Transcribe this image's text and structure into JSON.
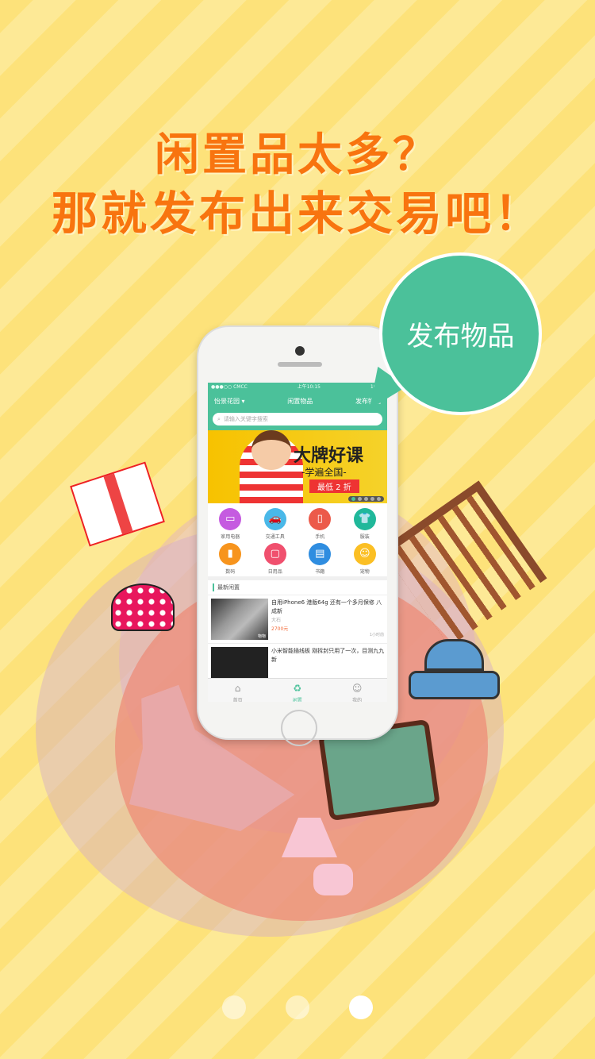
{
  "headline": {
    "line1": "闲置品太多？",
    "line2": "那就发布出来交易吧！"
  },
  "bubble": "发布物品",
  "phone": {
    "status": {
      "carrier": "●●●○○ CMCC",
      "time": "上午10:15",
      "battery": "100%"
    },
    "nav": {
      "location": "怡景花园 ▾",
      "title": "闲置物品",
      "publish": "发布物品"
    },
    "search_placeholder": "请输入关键字搜索",
    "banner": {
      "title": "大牌好课",
      "subtitle": "-学遍全国-",
      "promo": "最低 2 折"
    },
    "categories": [
      {
        "label": "家用电器",
        "icon": "▭",
        "color": "#c55be0"
      },
      {
        "label": "交通工具",
        "icon": "🚗",
        "color": "#4ab8e8"
      },
      {
        "label": "手机",
        "icon": "▯",
        "color": "#ec5a4a"
      },
      {
        "label": "服装",
        "icon": "👕",
        "color": "#20b89a"
      },
      {
        "label": "数码",
        "icon": "▮",
        "color": "#f7941d"
      },
      {
        "label": "日用品",
        "icon": "▢",
        "color": "#f0506e"
      },
      {
        "label": "书籍",
        "icon": "▤",
        "color": "#2f8de0"
      },
      {
        "label": "宠物",
        "icon": "☺",
        "color": "#fbbf24"
      }
    ],
    "section_title": "最新闲置",
    "items": [
      {
        "title": "自用iPhone6 港版64g 还有一个多月保修 八成新",
        "seller": "大石",
        "price": "2700元",
        "time": "1小时前",
        "tag": "物物"
      },
      {
        "title": "小米智能插线板 刚拆封只用了一次，目测九九新"
      }
    ],
    "tabs": [
      {
        "label": "首页",
        "icon": "⌂"
      },
      {
        "label": "闲置",
        "icon": "♻"
      },
      {
        "label": "我的",
        "icon": "☺"
      }
    ]
  },
  "pager": {
    "count": 3,
    "active": 3
  }
}
